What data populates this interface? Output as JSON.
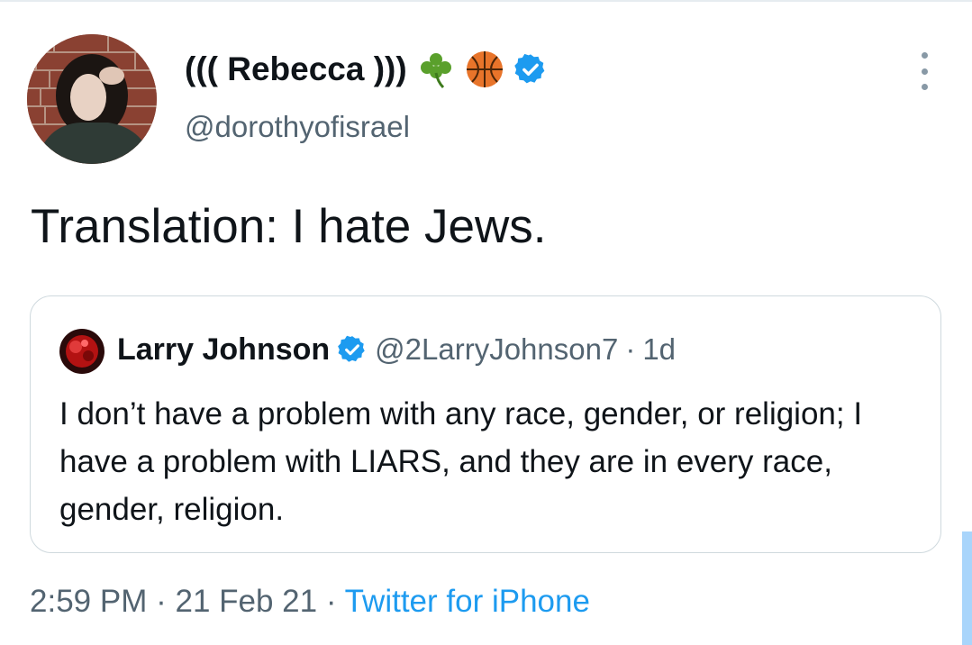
{
  "author": {
    "display_name": "((( Rebecca )))",
    "handle": "@dorothyofisrael",
    "name_emojis": [
      "shamrock-icon",
      "basketball-icon"
    ],
    "verified": true
  },
  "tweet": {
    "text": "Translation: I hate Jews."
  },
  "quoted_tweet": {
    "author_name": "Larry Johnson",
    "handle": "@2LarryJohnson7",
    "separator": "·",
    "time": "1d",
    "verified": true,
    "text": "I don’t have a problem with any race, gender, or religion; I have a problem with LIARS, and they are in every race, gender, religion."
  },
  "meta": {
    "time": "2:59 PM",
    "separator": "·",
    "date": "21 Feb 21",
    "source": "Twitter for iPhone"
  },
  "colors": {
    "accent": "#1d9bf0",
    "text_primary": "#0f1419",
    "text_secondary": "#536471",
    "border": "#cfd9de"
  }
}
